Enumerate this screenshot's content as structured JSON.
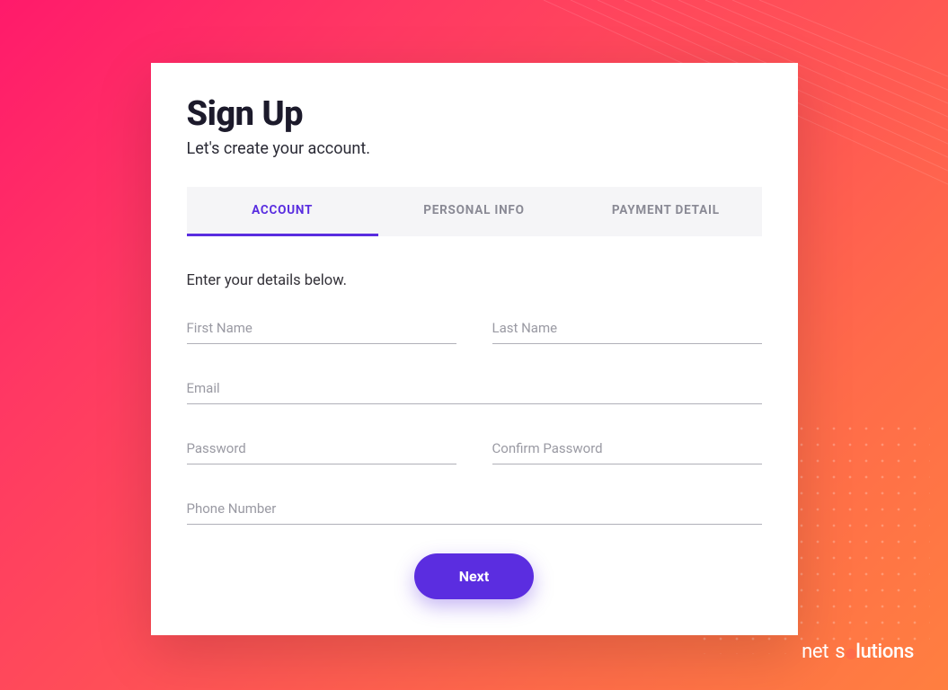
{
  "header": {
    "title": "Sign Up",
    "subtitle": "Let's create your account."
  },
  "tabs": {
    "account": "ACCOUNT",
    "personal": "PERSONAL INFO",
    "payment": "PAYMENT DETAIL"
  },
  "form": {
    "instructions": "Enter your details below.",
    "first_name_placeholder": "First Name",
    "last_name_placeholder": "Last Name",
    "email_placeholder": "Email",
    "password_placeholder": "Password",
    "confirm_password_placeholder": "Confirm Password",
    "phone_placeholder": "Phone Number",
    "next_label": "Next"
  },
  "branding": {
    "prefix": "net",
    "suffix": "s",
    "suffix2": "lutions"
  },
  "colors": {
    "accent": "#5b2de0",
    "gradient_start": "#ff1a6b",
    "gradient_end": "#ff7f40"
  }
}
